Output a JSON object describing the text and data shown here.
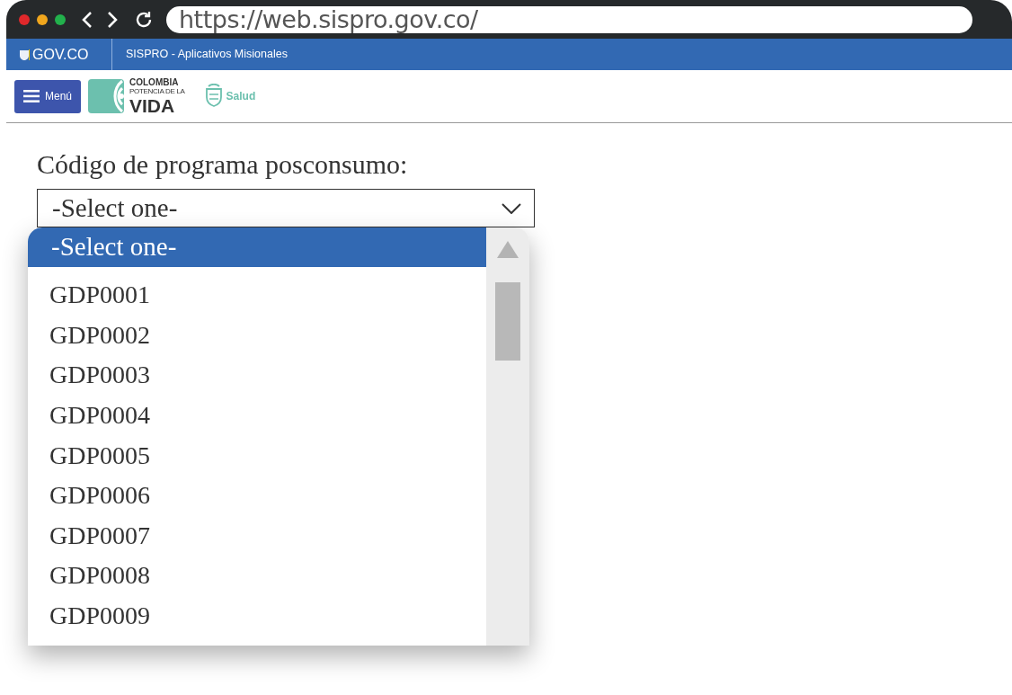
{
  "browser": {
    "url": "https://web.sispro.gov.co/"
  },
  "gov_bar": {
    "brand": "GOV.CO",
    "title": "SISPRO - Aplicativos Misionales"
  },
  "header": {
    "menu_button": "Menú",
    "logo": {
      "line_1": "COLOMBIA",
      "line_2": "POTENCIA DE LA",
      "line_3": "VIDA"
    },
    "ministry": "Salud"
  },
  "field": {
    "label": "Código de programa posconsumo:",
    "value": "-Select one-",
    "expanded": true
  },
  "dropdown": {
    "options": [
      {
        "label": "-Select one-",
        "selected": true
      },
      {
        "label": "GDP0001",
        "selected": false
      },
      {
        "label": "GDP0002",
        "selected": false
      },
      {
        "label": "GDP0003",
        "selected": false
      },
      {
        "label": "GDP0004",
        "selected": false
      },
      {
        "label": "GDP0005",
        "selected": false
      },
      {
        "label": "GDP0006",
        "selected": false
      },
      {
        "label": "GDP0007",
        "selected": false
      },
      {
        "label": "GDP0008",
        "selected": false
      },
      {
        "label": "GDP0009",
        "selected": false
      }
    ]
  }
}
